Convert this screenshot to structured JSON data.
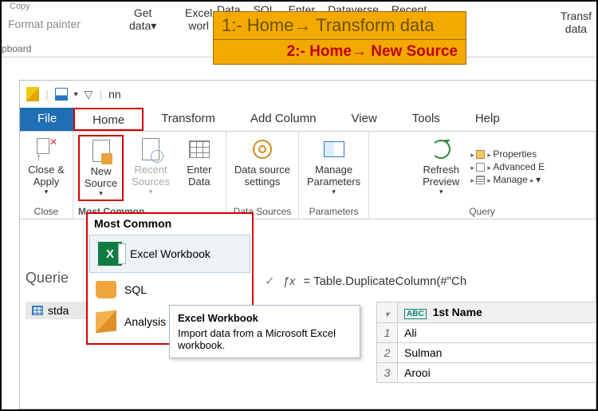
{
  "top": {
    "copy": "Copy",
    "format_painter": "Format painter",
    "pboard": "pboard",
    "get_data": "Get\ndata",
    "excel_cut": "Excel\nworl",
    "labels": [
      "Data",
      "SQL",
      "Enter",
      "Dataverse",
      "Recent"
    ],
    "transform": "Transf\ndata"
  },
  "callout": {
    "line1_pre": "1:- Home",
    "line1_post": " Transform data",
    "line2_pre": "2:- Home",
    "line2_post": " New Source"
  },
  "pq": {
    "title_doc": "nn",
    "tabs": {
      "file": "File",
      "home": "Home",
      "transform": "Transform",
      "add_column": "Add Column",
      "view": "View",
      "tools": "Tools",
      "help": "Help"
    },
    "ribbon": {
      "close_apply": "Close &\nApply",
      "close_caption": "Close",
      "new_source": "New\nSource",
      "recent_sources": "Recent\nSources",
      "enter_data": "Enter\nData",
      "new_query_caption": "Most Common",
      "ds_settings": "Data source\nsettings",
      "ds_caption": "Data Sources",
      "manage_params": "Manage\nParameters",
      "params_caption": "Parameters",
      "refresh": "Refresh\nPreview",
      "props": "Properties",
      "adv": "Advanced E",
      "manage": "Manage",
      "query_caption": "Query"
    },
    "dropdown": {
      "head": "Most Common",
      "excel": "Excel Workbook",
      "sql": "SQL",
      "analysis": "Analysis Services"
    },
    "tooltip": {
      "title": "Excel Workbook",
      "body": "Import data from a Microsoft Excel workbook."
    },
    "queries_label": "Querie",
    "query_item": "stda",
    "formula": {
      "check": "✓",
      "fx": "ƒx",
      "text": "= Table.DuplicateColumn(#\"Ch"
    },
    "grid": {
      "col_type": "ABC",
      "col_name": "1st Name",
      "rows": [
        {
          "n": "1",
          "v": "Ali"
        },
        {
          "n": "2",
          "v": "Sulman"
        },
        {
          "n": "3",
          "v": "Arooi"
        }
      ]
    }
  }
}
